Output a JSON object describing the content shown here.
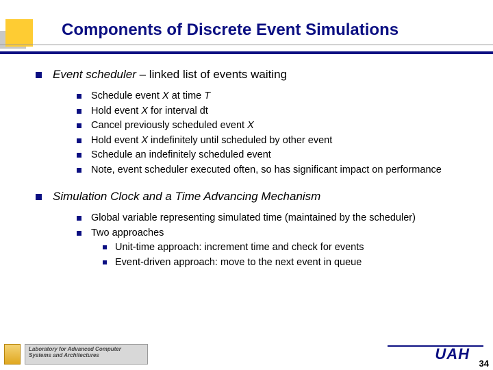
{
  "title": "Components of Discrete Event Simulations",
  "points": [
    {
      "lead": "Event scheduler",
      "rest": " – linked list of events waiting",
      "subs": [
        {
          "text": "Schedule event ",
          "italic1": "X",
          "mid": " at time ",
          "italic2": "T"
        },
        {
          "text": "Hold event ",
          "italic1": "X",
          "mid": " for interval dt"
        },
        {
          "text": "Cancel previously scheduled event ",
          "italic1": "X"
        },
        {
          "text": "Hold event ",
          "italic1": "X",
          "mid": " indefinitely until scheduled by other event"
        },
        {
          "text": "Schedule an indefinitely scheduled event"
        },
        {
          "text": "Note, event scheduler executed often, so has significant impact on performance"
        }
      ]
    },
    {
      "lead": "Simulation Clock and a Time Advancing Mechanism",
      "rest": "",
      "leadItalic": true,
      "subs": [
        {
          "text": "Global variable representing simulated time (maintained by the scheduler)"
        },
        {
          "text": "Two approaches",
          "subsubs": [
            {
              "text": "Unit-time approach: increment time and check for events"
            },
            {
              "text": "Event-driven approach: move to the next event in queue"
            }
          ]
        }
      ]
    }
  ],
  "footer": {
    "lab_line1": "Laboratory for Advanced Computer",
    "lab_line2": "Systems and Architectures",
    "logo": "UAH",
    "page": "34"
  }
}
